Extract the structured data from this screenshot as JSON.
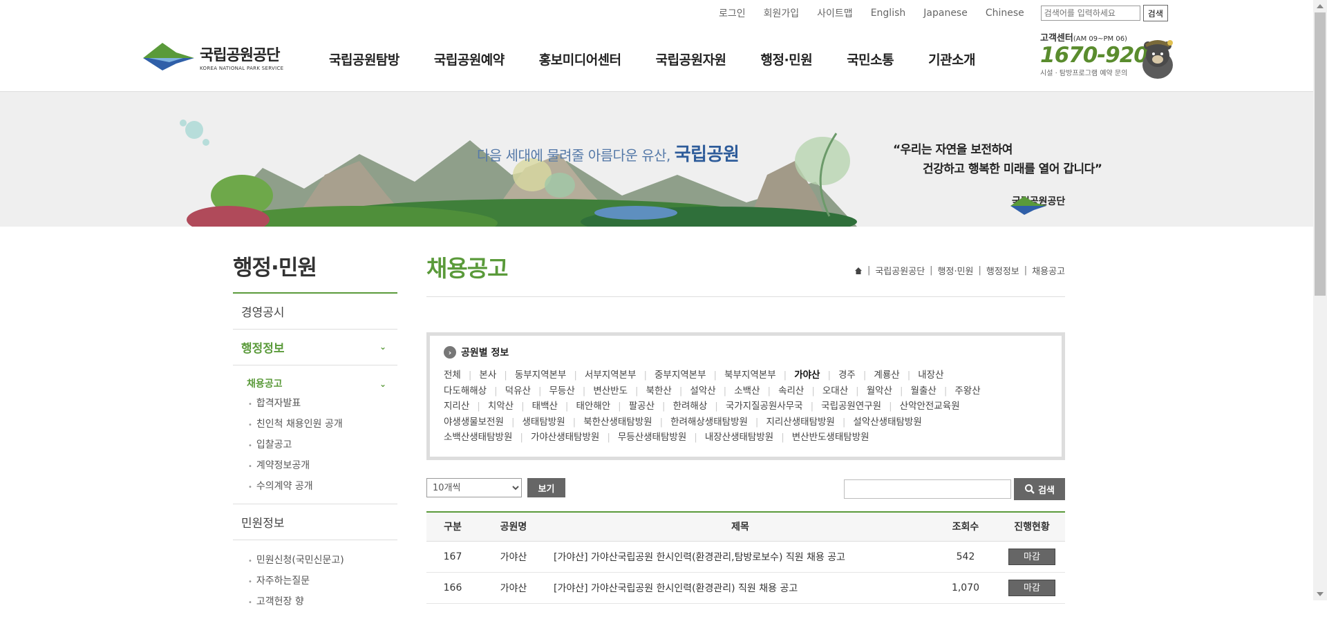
{
  "util": {
    "links": [
      "로그인",
      "회원가입",
      "사이트맵",
      "English",
      "Japanese",
      "Chinese"
    ],
    "search_placeholder": "검색어를 입력하세요",
    "search_button": "검색"
  },
  "logo": {
    "ko": "국립공원공단",
    "en": "KOREA NATIONAL PARK SERVICE"
  },
  "gnb": [
    "국립공원탐방",
    "국립공원예약",
    "홍보미디어센터",
    "국립공원자원",
    "행정·민원",
    "국민소통",
    "기관소개"
  ],
  "cs": {
    "title": "고객센터",
    "hours": "(AM 09~PM 06)",
    "phone": "1670-9201",
    "sub": "시설 · 탐방프로그램 예약 문의"
  },
  "banner": {
    "slogan_prefix": "다음 세대에 물려줄 아름다운 유산,",
    "slogan_bold": "국립공원",
    "quote_line1": "“우리는 자연을 보전하여",
    "quote_line2": "건강하고 행복한 미래를 열어 갑니다”",
    "org": "국립공원공단"
  },
  "sidebar": {
    "title": "행정·민원",
    "items": [
      {
        "label": "경영공시"
      },
      {
        "label": "행정정보"
      }
    ],
    "sub_head": "채용공고",
    "sub_items": [
      "합격자발표",
      "친인척 채용인원 공개",
      "입찰공고",
      "계약정보공개",
      "수의계약 공개"
    ],
    "item_after": "민원정보",
    "sub2_items": [
      "민원신청(국민신문고)",
      "자주하는질문",
      "고객헌장 향"
    ]
  },
  "content": {
    "title": "채용공고",
    "breadcrumb": [
      "국립공원공단",
      "행정·민원",
      "행정정보",
      "채용공고"
    ],
    "park_head": "공원별 정보",
    "parks": [
      [
        "전체",
        "본사",
        "동부지역본부",
        "서부지역본부",
        "중부지역본부",
        "북부지역본부",
        "가야산",
        "경주",
        "계룡산",
        "내장산"
      ],
      [
        "다도해해상",
        "덕유산",
        "무등산",
        "변산반도",
        "북한산",
        "설악산",
        "소백산",
        "속리산",
        "오대산",
        "월악산",
        "월출산",
        "주왕산"
      ],
      [
        "지리산",
        "치악산",
        "태백산",
        "태안해안",
        "팔공산",
        "한려해상",
        "국가지질공원사무국",
        "국립공원연구원",
        "산악안전교육원"
      ],
      [
        "야생생물보전원",
        "생태탐방원",
        "북한산생태탐방원",
        "한려해상생태탐방원",
        "지리산생태탐방원",
        "설악산생태탐방원"
      ],
      [
        "소백산생태탐방원",
        "가야산생태탐방원",
        "무등산생태탐방원",
        "내장산생태탐방원",
        "변산반도생태탐방원"
      ]
    ],
    "selected_park": "가야산",
    "page_size": "10개씩",
    "view_button": "보기",
    "search_button": "검색",
    "table": {
      "headers": [
        "구분",
        "공원명",
        "제목",
        "조회수",
        "진행현황"
      ],
      "rows": [
        {
          "no": "167",
          "park": "가야산",
          "title": "[가야산] 가야산국립공원 한시인력(환경관리,탐방로보수) 직원 채용 공고",
          "views": "542",
          "status": "마감"
        },
        {
          "no": "166",
          "park": "가야산",
          "title": "[가야산] 가야산국립공원 한시인력(환경관리) 직원 채용 공고",
          "views": "1,070",
          "status": "마감"
        }
      ]
    }
  }
}
